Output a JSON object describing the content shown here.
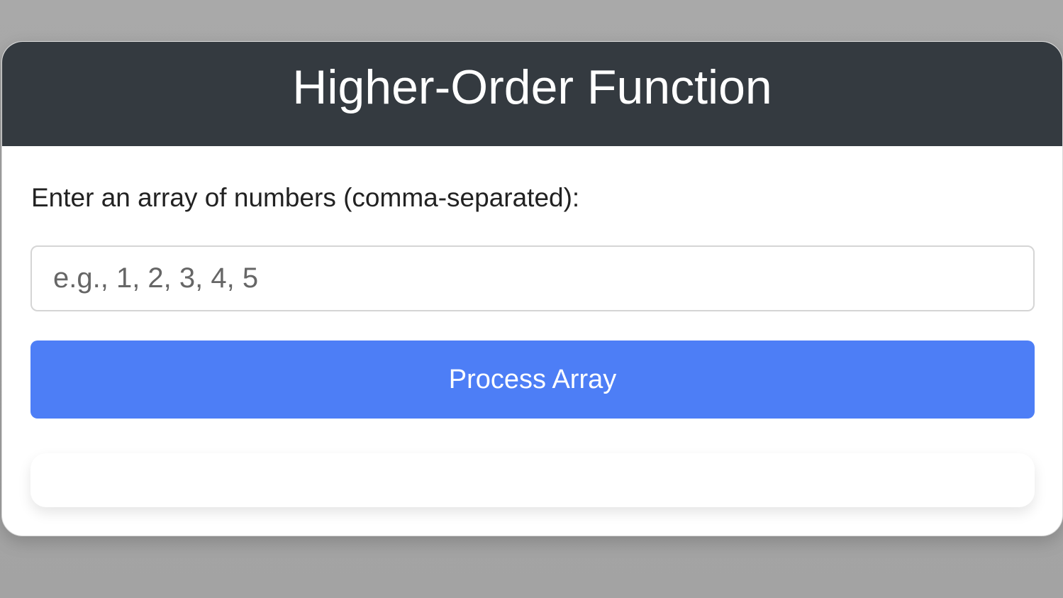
{
  "header": {
    "title": "Higher-Order Function"
  },
  "form": {
    "prompt": "Enter an array of numbers (comma-separated):",
    "input_placeholder": "e.g., 1, 2, 3, 4, 5",
    "input_value": "",
    "button_label": "Process Array"
  },
  "result": {
    "text": ""
  },
  "colors": {
    "header_bg": "#343a40",
    "button_bg": "#4d7ef6",
    "page_bg": "#a9a9a9"
  }
}
